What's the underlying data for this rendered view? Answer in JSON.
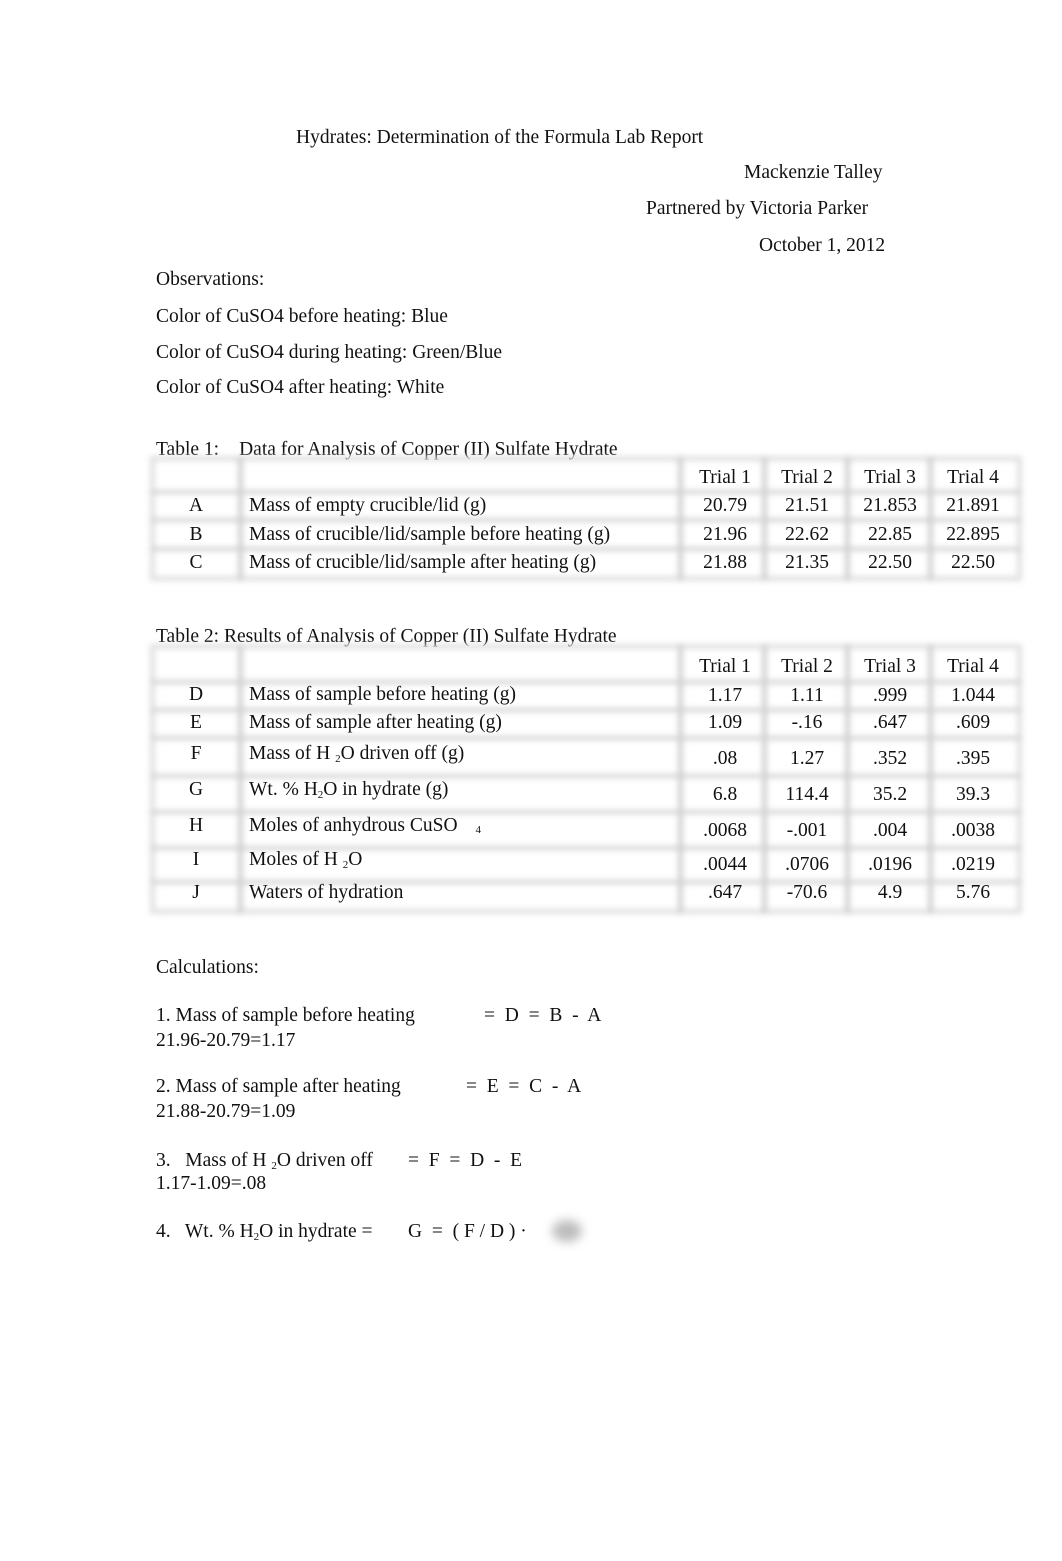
{
  "header": {
    "title": "Hydrates: Determination of the Formula Lab Report",
    "author": "Mackenzie Talley",
    "partner": "Partnered by Victoria Parker",
    "date": "October 1, 2012"
  },
  "observations": {
    "heading": "Observations:",
    "items": [
      "Color of CuSO4 before heating: Blue",
      "Color of CuSO4 during heating: Green/Blue",
      "Color of CuSO4 after heating: White"
    ]
  },
  "table1": {
    "caption_label": "Table 1:",
    "caption_text": "Data for Analysis of Copper (II) Sulfate Hydrate",
    "columns": [
      "Trial 1",
      "Trial 2",
      "Trial 3",
      "Trial 4"
    ],
    "rows": [
      {
        "letter": "A",
        "desc": "Mass of empty crucible/lid (g)",
        "values": [
          "20.79",
          "21.51",
          "21.853",
          "21.891"
        ]
      },
      {
        "letter": "B",
        "desc": "Mass of crucible/lid/sample before heating (g)",
        "values": [
          "21.96",
          "22.62",
          "22.85",
          "22.895"
        ]
      },
      {
        "letter": "C",
        "desc": "Mass of crucible/lid/sample after heating (g)",
        "values": [
          "21.88",
          "21.35",
          "22.50",
          "22.50"
        ]
      }
    ]
  },
  "table2": {
    "caption": "Table 2: Results of Analysis of Copper (II) Sulfate Hydrate",
    "columns": [
      "Trial 1",
      "Trial 2",
      "Trial 3",
      "Trial 4"
    ],
    "rows": [
      {
        "letter": "D",
        "desc": "Mass of sample before heating (g)",
        "values": [
          "1.17",
          "1.11",
          ".999",
          "1.044"
        ]
      },
      {
        "letter": "E",
        "desc": "Mass of sample after heating (g)",
        "values": [
          "1.09",
          "-.16",
          ".647",
          ".609"
        ]
      },
      {
        "letter": "F",
        "desc_pre": "Mass of H ",
        "desc_sub": "2",
        "desc_post": "O driven off (g)",
        "values": [
          ".08",
          "1.27",
          ".352",
          ".395"
        ]
      },
      {
        "letter": "G",
        "desc_pre": "Wt. % H",
        "desc_sub": "2",
        "desc_post": "O in hydrate (g)",
        "values": [
          "6.8",
          "114.4",
          "35.2",
          "39.3"
        ]
      },
      {
        "letter": "H",
        "desc_pre": "Moles of anhydrous CuSO",
        "desc_sub": "4",
        "desc_post": "",
        "values": [
          ".0068",
          "-.001",
          ".004",
          ".0038"
        ]
      },
      {
        "letter": "I",
        "desc_pre": "Moles of H ",
        "desc_sub": "2",
        "desc_post": "O",
        "values": [
          ".0044",
          ".0706",
          ".0196",
          ".0219"
        ]
      },
      {
        "letter": "J",
        "desc": "Waters of hydration",
        "values": [
          ".647",
          "-70.6",
          "4.9",
          "5.76"
        ]
      }
    ]
  },
  "calculations": {
    "heading": "Calculations:",
    "items": [
      {
        "label": "1.   Mass of sample before heating",
        "formula": "=  D  =  B  -  A",
        "work": "21.96-20.79=1.17"
      },
      {
        "label": "2.   Mass of sample after heating",
        "formula": "=  E  =  C  -  A",
        "work": "21.88-20.79=1.09"
      },
      {
        "label_pre": "3.   Mass of H ",
        "label_sub": "2",
        "label_post": "O driven off",
        "formula": "=  F  =  D  -  E",
        "work": "1.17-1.09=.08"
      },
      {
        "label_pre": "4.   Wt. % H",
        "label_sub": "2",
        "label_post": "O in hydrate =",
        "formula": "G  =  ( F / D ) ·"
      }
    ]
  }
}
